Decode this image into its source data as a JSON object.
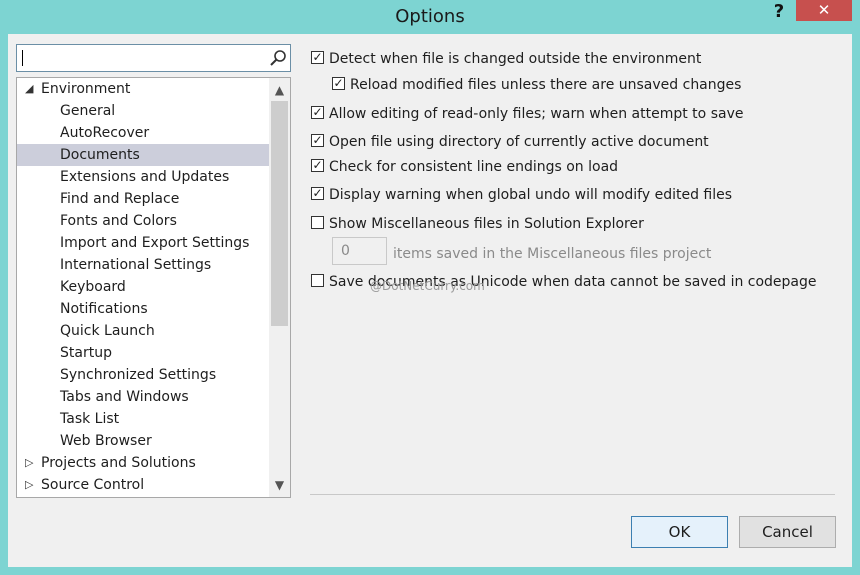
{
  "window": {
    "title": "Options",
    "help_label": "?",
    "close_label": "✕"
  },
  "search": {
    "value": ""
  },
  "tree": {
    "items": [
      {
        "label": "Environment",
        "level": 0,
        "expanded": true
      },
      {
        "label": "General",
        "level": 1
      },
      {
        "label": "AutoRecover",
        "level": 1
      },
      {
        "label": "Documents",
        "level": 1,
        "selected": true
      },
      {
        "label": "Extensions and Updates",
        "level": 1
      },
      {
        "label": "Find and Replace",
        "level": 1
      },
      {
        "label": "Fonts and Colors",
        "level": 1
      },
      {
        "label": "Import and Export Settings",
        "level": 1
      },
      {
        "label": "International Settings",
        "level": 1
      },
      {
        "label": "Keyboard",
        "level": 1
      },
      {
        "label": "Notifications",
        "level": 1
      },
      {
        "label": "Quick Launch",
        "level": 1
      },
      {
        "label": "Startup",
        "level": 1
      },
      {
        "label": "Synchronized Settings",
        "level": 1
      },
      {
        "label": "Tabs and Windows",
        "level": 1
      },
      {
        "label": "Task List",
        "level": 1
      },
      {
        "label": "Web Browser",
        "level": 1
      },
      {
        "label": "Projects and Solutions",
        "level": 0,
        "expanded": false
      },
      {
        "label": "Source Control",
        "level": 0,
        "expanded": false
      }
    ]
  },
  "options": {
    "detect_changes": {
      "label": "Detect when file is changed outside the environment",
      "checked": true
    },
    "reload_modified": {
      "label": "Reload modified files unless there are unsaved changes",
      "checked": true
    },
    "allow_readonly": {
      "label": "Allow editing of read-only files; warn when attempt to save",
      "checked": true
    },
    "open_directory": {
      "label": "Open file using directory of currently active document",
      "checked": true
    },
    "line_endings": {
      "label": "Check for consistent line endings on load",
      "checked": true
    },
    "global_undo": {
      "label": "Display warning when global undo will modify edited files",
      "checked": true
    },
    "show_misc": {
      "label": "Show Miscellaneous files in Solution Explorer",
      "checked": false
    },
    "misc_count_value": "0",
    "misc_count_label": "items saved in the Miscellaneous files project",
    "save_unicode": {
      "label": "Save documents as Unicode when data cannot be saved in codepage",
      "checked": false
    }
  },
  "watermark": "@DotNetCurry.com",
  "buttons": {
    "ok": "OK",
    "cancel": "Cancel"
  }
}
